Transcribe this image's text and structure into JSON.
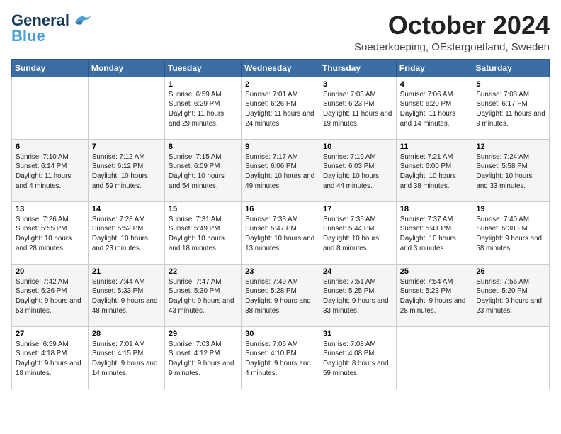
{
  "header": {
    "logo_general": "General",
    "logo_blue": "Blue",
    "month_title": "October 2024",
    "location": "Soederkoeping, OEstergoetland, Sweden"
  },
  "weekdays": [
    "Sunday",
    "Monday",
    "Tuesday",
    "Wednesday",
    "Thursday",
    "Friday",
    "Saturday"
  ],
  "weeks": [
    [
      {
        "day": "",
        "sunrise": "",
        "sunset": "",
        "daylight": ""
      },
      {
        "day": "",
        "sunrise": "",
        "sunset": "",
        "daylight": ""
      },
      {
        "day": "1",
        "sunrise": "Sunrise: 6:59 AM",
        "sunset": "Sunset: 6:29 PM",
        "daylight": "Daylight: 11 hours and 29 minutes."
      },
      {
        "day": "2",
        "sunrise": "Sunrise: 7:01 AM",
        "sunset": "Sunset: 6:26 PM",
        "daylight": "Daylight: 11 hours and 24 minutes."
      },
      {
        "day": "3",
        "sunrise": "Sunrise: 7:03 AM",
        "sunset": "Sunset: 6:23 PM",
        "daylight": "Daylight: 11 hours and 19 minutes."
      },
      {
        "day": "4",
        "sunrise": "Sunrise: 7:06 AM",
        "sunset": "Sunset: 6:20 PM",
        "daylight": "Daylight: 11 hours and 14 minutes."
      },
      {
        "day": "5",
        "sunrise": "Sunrise: 7:08 AM",
        "sunset": "Sunset: 6:17 PM",
        "daylight": "Daylight: 11 hours and 9 minutes."
      }
    ],
    [
      {
        "day": "6",
        "sunrise": "Sunrise: 7:10 AM",
        "sunset": "Sunset: 6:14 PM",
        "daylight": "Daylight: 11 hours and 4 minutes."
      },
      {
        "day": "7",
        "sunrise": "Sunrise: 7:12 AM",
        "sunset": "Sunset: 6:12 PM",
        "daylight": "Daylight: 10 hours and 59 minutes."
      },
      {
        "day": "8",
        "sunrise": "Sunrise: 7:15 AM",
        "sunset": "Sunset: 6:09 PM",
        "daylight": "Daylight: 10 hours and 54 minutes."
      },
      {
        "day": "9",
        "sunrise": "Sunrise: 7:17 AM",
        "sunset": "Sunset: 6:06 PM",
        "daylight": "Daylight: 10 hours and 49 minutes."
      },
      {
        "day": "10",
        "sunrise": "Sunrise: 7:19 AM",
        "sunset": "Sunset: 6:03 PM",
        "daylight": "Daylight: 10 hours and 44 minutes."
      },
      {
        "day": "11",
        "sunrise": "Sunrise: 7:21 AM",
        "sunset": "Sunset: 6:00 PM",
        "daylight": "Daylight: 10 hours and 38 minutes."
      },
      {
        "day": "12",
        "sunrise": "Sunrise: 7:24 AM",
        "sunset": "Sunset: 5:58 PM",
        "daylight": "Daylight: 10 hours and 33 minutes."
      }
    ],
    [
      {
        "day": "13",
        "sunrise": "Sunrise: 7:26 AM",
        "sunset": "Sunset: 5:55 PM",
        "daylight": "Daylight: 10 hours and 28 minutes."
      },
      {
        "day": "14",
        "sunrise": "Sunrise: 7:28 AM",
        "sunset": "Sunset: 5:52 PM",
        "daylight": "Daylight: 10 hours and 23 minutes."
      },
      {
        "day": "15",
        "sunrise": "Sunrise: 7:31 AM",
        "sunset": "Sunset: 5:49 PM",
        "daylight": "Daylight: 10 hours and 18 minutes."
      },
      {
        "day": "16",
        "sunrise": "Sunrise: 7:33 AM",
        "sunset": "Sunset: 5:47 PM",
        "daylight": "Daylight: 10 hours and 13 minutes."
      },
      {
        "day": "17",
        "sunrise": "Sunrise: 7:35 AM",
        "sunset": "Sunset: 5:44 PM",
        "daylight": "Daylight: 10 hours and 8 minutes."
      },
      {
        "day": "18",
        "sunrise": "Sunrise: 7:37 AM",
        "sunset": "Sunset: 5:41 PM",
        "daylight": "Daylight: 10 hours and 3 minutes."
      },
      {
        "day": "19",
        "sunrise": "Sunrise: 7:40 AM",
        "sunset": "Sunset: 5:38 PM",
        "daylight": "Daylight: 9 hours and 58 minutes."
      }
    ],
    [
      {
        "day": "20",
        "sunrise": "Sunrise: 7:42 AM",
        "sunset": "Sunset: 5:36 PM",
        "daylight": "Daylight: 9 hours and 53 minutes."
      },
      {
        "day": "21",
        "sunrise": "Sunrise: 7:44 AM",
        "sunset": "Sunset: 5:33 PM",
        "daylight": "Daylight: 9 hours and 48 minutes."
      },
      {
        "day": "22",
        "sunrise": "Sunrise: 7:47 AM",
        "sunset": "Sunset: 5:30 PM",
        "daylight": "Daylight: 9 hours and 43 minutes."
      },
      {
        "day": "23",
        "sunrise": "Sunrise: 7:49 AM",
        "sunset": "Sunset: 5:28 PM",
        "daylight": "Daylight: 9 hours and 38 minutes."
      },
      {
        "day": "24",
        "sunrise": "Sunrise: 7:51 AM",
        "sunset": "Sunset: 5:25 PM",
        "daylight": "Daylight: 9 hours and 33 minutes."
      },
      {
        "day": "25",
        "sunrise": "Sunrise: 7:54 AM",
        "sunset": "Sunset: 5:23 PM",
        "daylight": "Daylight: 9 hours and 28 minutes."
      },
      {
        "day": "26",
        "sunrise": "Sunrise: 7:56 AM",
        "sunset": "Sunset: 5:20 PM",
        "daylight": "Daylight: 9 hours and 23 minutes."
      }
    ],
    [
      {
        "day": "27",
        "sunrise": "Sunrise: 6:59 AM",
        "sunset": "Sunset: 4:18 PM",
        "daylight": "Daylight: 9 hours and 18 minutes."
      },
      {
        "day": "28",
        "sunrise": "Sunrise: 7:01 AM",
        "sunset": "Sunset: 4:15 PM",
        "daylight": "Daylight: 9 hours and 14 minutes."
      },
      {
        "day": "29",
        "sunrise": "Sunrise: 7:03 AM",
        "sunset": "Sunset: 4:12 PM",
        "daylight": "Daylight: 9 hours and 9 minutes."
      },
      {
        "day": "30",
        "sunrise": "Sunrise: 7:06 AM",
        "sunset": "Sunset: 4:10 PM",
        "daylight": "Daylight: 9 hours and 4 minutes."
      },
      {
        "day": "31",
        "sunrise": "Sunrise: 7:08 AM",
        "sunset": "Sunset: 4:08 PM",
        "daylight": "Daylight: 8 hours and 59 minutes."
      },
      {
        "day": "",
        "sunrise": "",
        "sunset": "",
        "daylight": ""
      },
      {
        "day": "",
        "sunrise": "",
        "sunset": "",
        "daylight": ""
      }
    ]
  ]
}
